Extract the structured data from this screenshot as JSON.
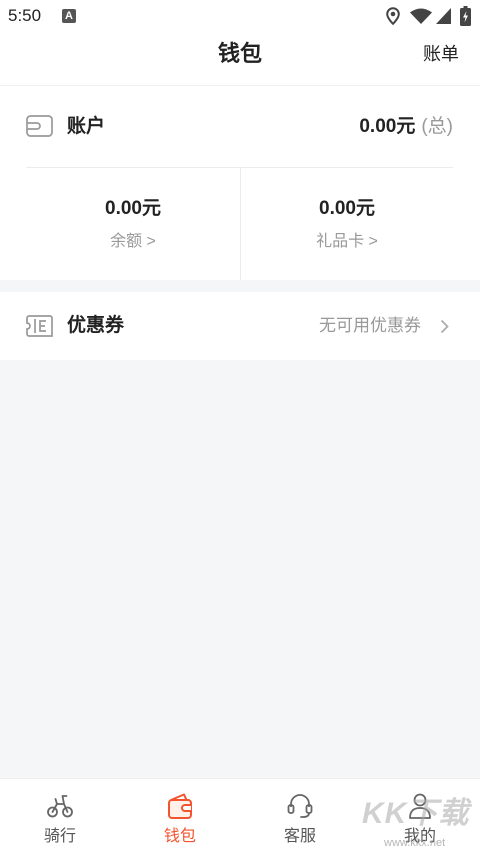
{
  "status_bar": {
    "time": "5:50",
    "notification_glyph": "A",
    "notification_icon": "a-notification-icon",
    "icons": [
      "location-icon",
      "wifi-icon",
      "signal-icon",
      "battery-charging-icon"
    ]
  },
  "header": {
    "title": "钱包",
    "action": "账单"
  },
  "account": {
    "icon": "card-icon",
    "label": "账户",
    "total_value": "0.00元",
    "total_suffix": "(总)",
    "balance": {
      "value": "0.00元",
      "label": "余额 >"
    },
    "gift_card": {
      "value": "0.00元",
      "label": "礼品卡 >"
    }
  },
  "coupon": {
    "icon": "ticket-icon",
    "label": "优惠券",
    "status": "无可用优惠券"
  },
  "tabs": [
    {
      "label": "骑行",
      "icon": "bike-icon",
      "active": false
    },
    {
      "label": "钱包",
      "icon": "wallet-icon",
      "active": true
    },
    {
      "label": "客服",
      "icon": "headset-icon",
      "active": false
    },
    {
      "label": "我的",
      "icon": "person-icon",
      "active": false
    }
  ],
  "colors": {
    "accent": "#f4532f",
    "page_background": "#f5f6f8",
    "card_background": "#ffffff",
    "text": "#222222",
    "muted_text": "#999999"
  },
  "watermark": {
    "brand": "KK下载",
    "url": "www.kkx.net"
  }
}
